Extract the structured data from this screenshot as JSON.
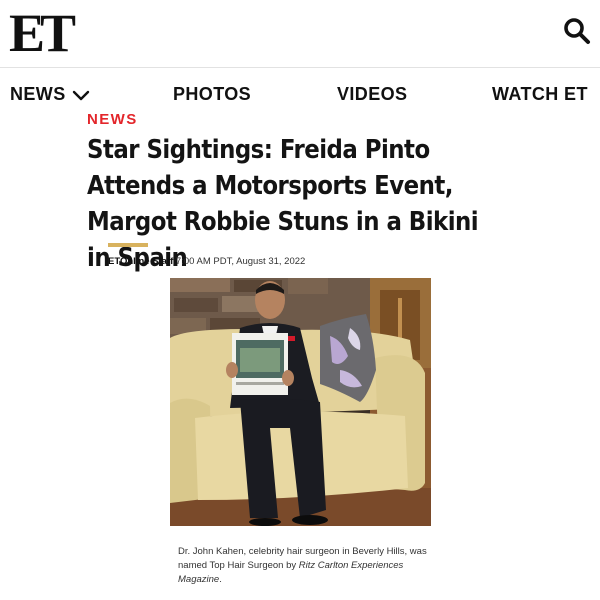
{
  "header": {
    "logo_text": "ET",
    "search_icon": "search-icon"
  },
  "nav": {
    "items": [
      {
        "label": "NEWS",
        "has_dropdown": true
      },
      {
        "label": "PHOTOS"
      },
      {
        "label": "VIDEOS"
      },
      {
        "label": "WATCH ET"
      }
    ],
    "dropdown_icon": "chevron-down-icon"
  },
  "article": {
    "category": "NEWS",
    "headline": "Star Sightings: Freida Pinto Attends a Motorsports Event, Margot Robbie Stuns in a Bikini in Spain",
    "author": "ETOnline Staff",
    "timestamp": "7:00 AM PDT, August 31, 2022",
    "caption_plain": "Dr. John Kahen, celebrity hair surgeon in Beverly Hills, was named Top Hair Surgeon by ",
    "caption_italic": "Ritz Carlton Experiences Magazine",
    "caption_end": "."
  },
  "colors": {
    "category_red": "#e3262b",
    "accent_gold": "#d8b25e",
    "text_dark": "#141414"
  }
}
